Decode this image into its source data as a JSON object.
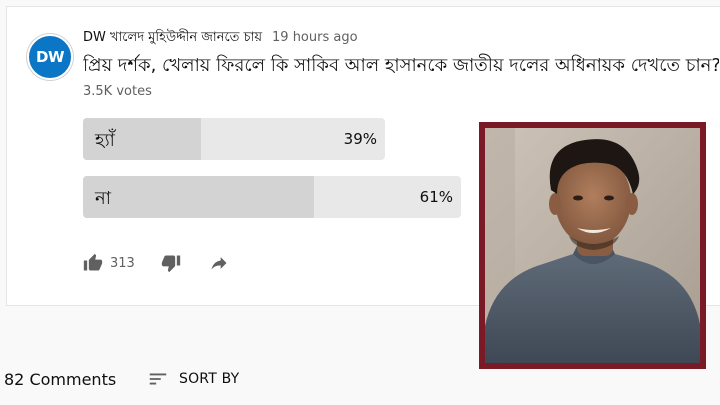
{
  "post": {
    "avatar_text": "DW",
    "channel_name": "DW খালেদ মুহিউদ্দীন জানতে চায়",
    "time": "19 hours ago",
    "question": "প্রিয় দর্শক, খেলায় ফিরলে কি সাকিব আল হাসানকে জাতীয় দলের অধিনায়ক দেখতে চান?",
    "votes": "3.5K votes",
    "options": [
      {
        "label": "হ্যাঁ",
        "percent_text": "39%",
        "percent": 39
      },
      {
        "label": "না",
        "percent_text": "61%",
        "percent": 61
      }
    ],
    "like_count": "313"
  },
  "comments": {
    "count_label": "82 Comments",
    "sort_label": "SORT BY"
  },
  "overlay": {
    "frame_color": "#7a1a26"
  },
  "icons": [
    "thumbs-up-icon",
    "thumbs-down-icon",
    "share-icon",
    "sort-icon"
  ]
}
